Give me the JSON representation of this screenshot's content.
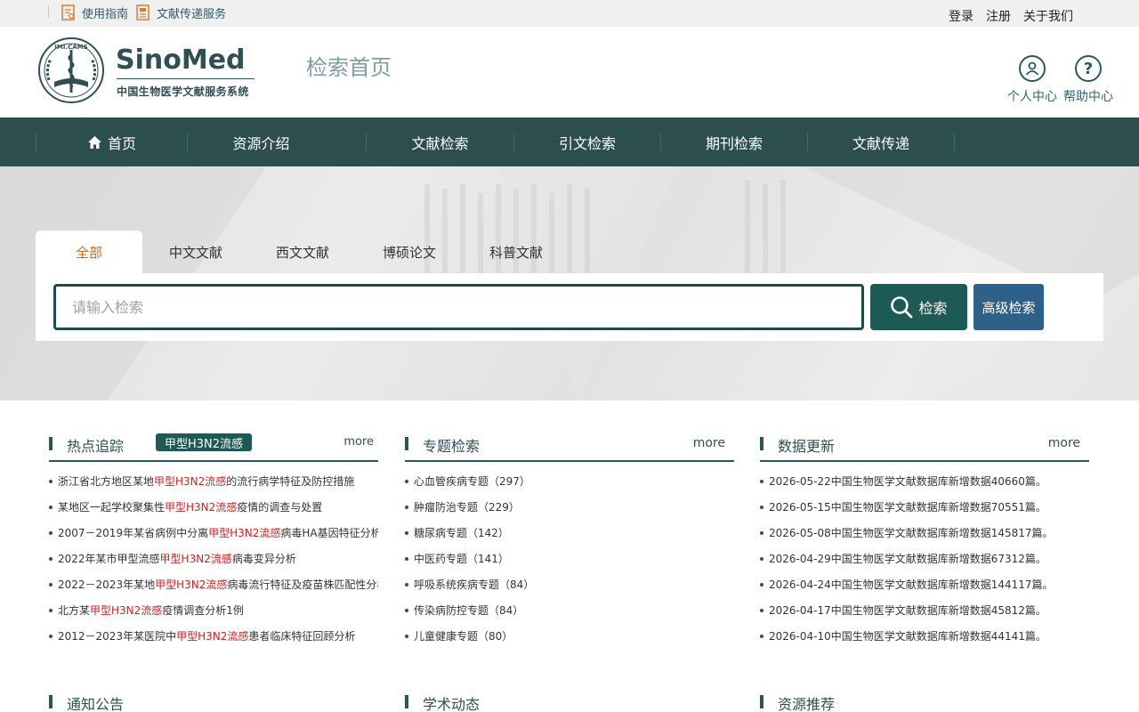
{
  "topbar": {
    "links": [
      {
        "label": "使用指南",
        "icon": "guide-icon"
      },
      {
        "label": "文献传递服务",
        "icon": "document-delivery-icon"
      }
    ],
    "right": [
      "登录",
      "注册",
      "关于我们"
    ]
  },
  "header": {
    "logo_text": "SinoMed",
    "logo_subtitle": "中国生物医学文献服务系统",
    "site_name": "检索首页",
    "buttons": [
      {
        "label": "个人中心",
        "icon": "user-icon"
      },
      {
        "label": "帮助中心",
        "icon": "help-icon"
      }
    ]
  },
  "nav": {
    "items": [
      "首页",
      "资源介绍",
      "文献检索",
      "引文检索",
      "期刊检索",
      "文献传递"
    ]
  },
  "search": {
    "tabs": [
      "全部",
      "中文文献",
      "西文文献",
      "博硕论文",
      "科普文献"
    ],
    "active_tab": 0,
    "placeholder": "请输入检索",
    "search_label": "检索",
    "advanced_label": "高级检索"
  },
  "columns": [
    {
      "title": "热点追踪",
      "badge": "甲型H3N2流感",
      "more": "more",
      "items": [
        [
          {
            "t": "浙江省北方地区某地"
          },
          {
            "t": "甲型H3N2流感",
            "hl": true
          },
          {
            "t": "的流行病学特征及防控措施"
          }
        ],
        [
          {
            "t": "某地区一起学校聚集性"
          },
          {
            "t": "甲型H3N2流感",
            "hl": true
          },
          {
            "t": "疫情的调查与处置"
          }
        ],
        [
          {
            "t": "2007－2019年某省病例中分离"
          },
          {
            "t": "甲型H3N2流感",
            "hl": true
          },
          {
            "t": "病毒HA基因特征分析"
          }
        ],
        [
          {
            "t": "2022年某市甲型流感"
          },
          {
            "t": "甲型H3N2流感",
            "hl": true
          },
          {
            "t": "病毒变异分析"
          }
        ],
        [
          {
            "t": "2022－2023年某地"
          },
          {
            "t": "甲型H3N2流感",
            "hl": true
          },
          {
            "t": "病毒流行特征及疫苗株匹配性分析研究报告"
          }
        ],
        [
          {
            "t": "北方某"
          },
          {
            "t": "甲型H3N2流感",
            "hl": true
          },
          {
            "t": "疫情调查分析1例"
          }
        ],
        [
          {
            "t": "2012－2023年某医院中"
          },
          {
            "t": "甲型H3N2流感",
            "hl": true
          },
          {
            "t": "患者临床特征回顾分析"
          }
        ]
      ]
    },
    {
      "title": "专题检索",
      "more": "more",
      "items": [
        [
          {
            "t": "心血管疾病专题（297）"
          }
        ],
        [
          {
            "t": "肿瘤防治专题（229）"
          }
        ],
        [
          {
            "t": "糖尿病专题（142）"
          }
        ],
        [
          {
            "t": "中医药专题（141）"
          }
        ],
        [
          {
            "t": "呼吸系统疾病专题（84）"
          }
        ],
        [
          {
            "t": "传染病防控专题（84）"
          }
        ],
        [
          {
            "t": "儿童健康专题（80）"
          }
        ]
      ]
    },
    {
      "title": "数据更新",
      "more": "more",
      "items": [
        [
          {
            "t": "2026-05-22中国生物医学文献数据库新增数据40660篇。"
          }
        ],
        [
          {
            "t": "2026-05-15中国生物医学文献数据库新增数据70551篇。"
          }
        ],
        [
          {
            "t": "2026-05-08中国生物医学文献数据库新增数据145817篇。"
          }
        ],
        [
          {
            "t": "2026-04-29中国生物医学文献数据库新增数据67312篇。"
          }
        ],
        [
          {
            "t": "2026-04-24中国生物医学文献数据库新增数据144117篇。"
          }
        ],
        [
          {
            "t": "2026-04-17中国生物医学文献数据库新增数据45812篇。"
          }
        ],
        [
          {
            "t": "2026-04-10中国生物医学文献数据库新增数据44141篇。"
          }
        ]
      ]
    }
  ],
  "bottom_columns": [
    "通知公告",
    "学术动态",
    "资源推荐"
  ],
  "colors": {
    "nav_bg": "#2c4e4c",
    "primary_button": "#1e5a55",
    "advanced_button": "#2e6189",
    "highlight": "#d42020",
    "active_tab": "#d2691e"
  }
}
